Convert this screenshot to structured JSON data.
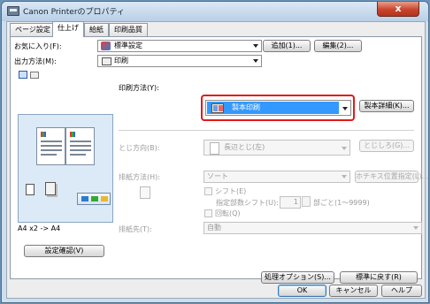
{
  "window": {
    "title": "Canon Printerのプロパティ",
    "close_label": "x"
  },
  "tabs": [
    {
      "label": "ページ設定",
      "active": false
    },
    {
      "label": "仕上げ",
      "active": true
    },
    {
      "label": "給紙",
      "active": false
    },
    {
      "label": "印刷品質",
      "active": false
    }
  ],
  "favorites": {
    "label": "お気に入り(F):",
    "value": "標準設定",
    "add_button": "追加(1)...",
    "edit_button": "編集(2)..."
  },
  "output_method": {
    "label": "出力方法(M):",
    "value": "印刷"
  },
  "preview": {
    "caption": "A4 x2 -> A4",
    "settings_button": "設定確認(V)"
  },
  "print_method": {
    "label": "印刷方法(Y):",
    "value": "製本印刷",
    "details_button": "製本詳細(K)..."
  },
  "binding": {
    "label": "とじ方向(B):",
    "value": "長辺とじ(左)",
    "margin_button": "とじしろ(G)..."
  },
  "paper_output": {
    "label": "排紙方法(H):",
    "value": "ソート",
    "staple_button": "ホチキス位置指定(L)..."
  },
  "shift": {
    "label": "シフト(E)",
    "offset_label": "指定部数シフト(U):",
    "offset_value": "1",
    "offset_range": "部ごと(1～9999)"
  },
  "rotate": {
    "label": "回転(Q)"
  },
  "output_tray": {
    "label": "排紙先(T):",
    "value": "自動"
  },
  "footer": {
    "options_button": "処理オプション(S)...",
    "defaults_button": "標準に戻す(R)",
    "ok_button": "OK",
    "cancel_button": "キャンセル",
    "help_button": "ヘルプ"
  },
  "colors": {
    "selection": "#3399ff",
    "highlight_frame": "#e11a1a",
    "preview_bg": "#dceaf7"
  }
}
